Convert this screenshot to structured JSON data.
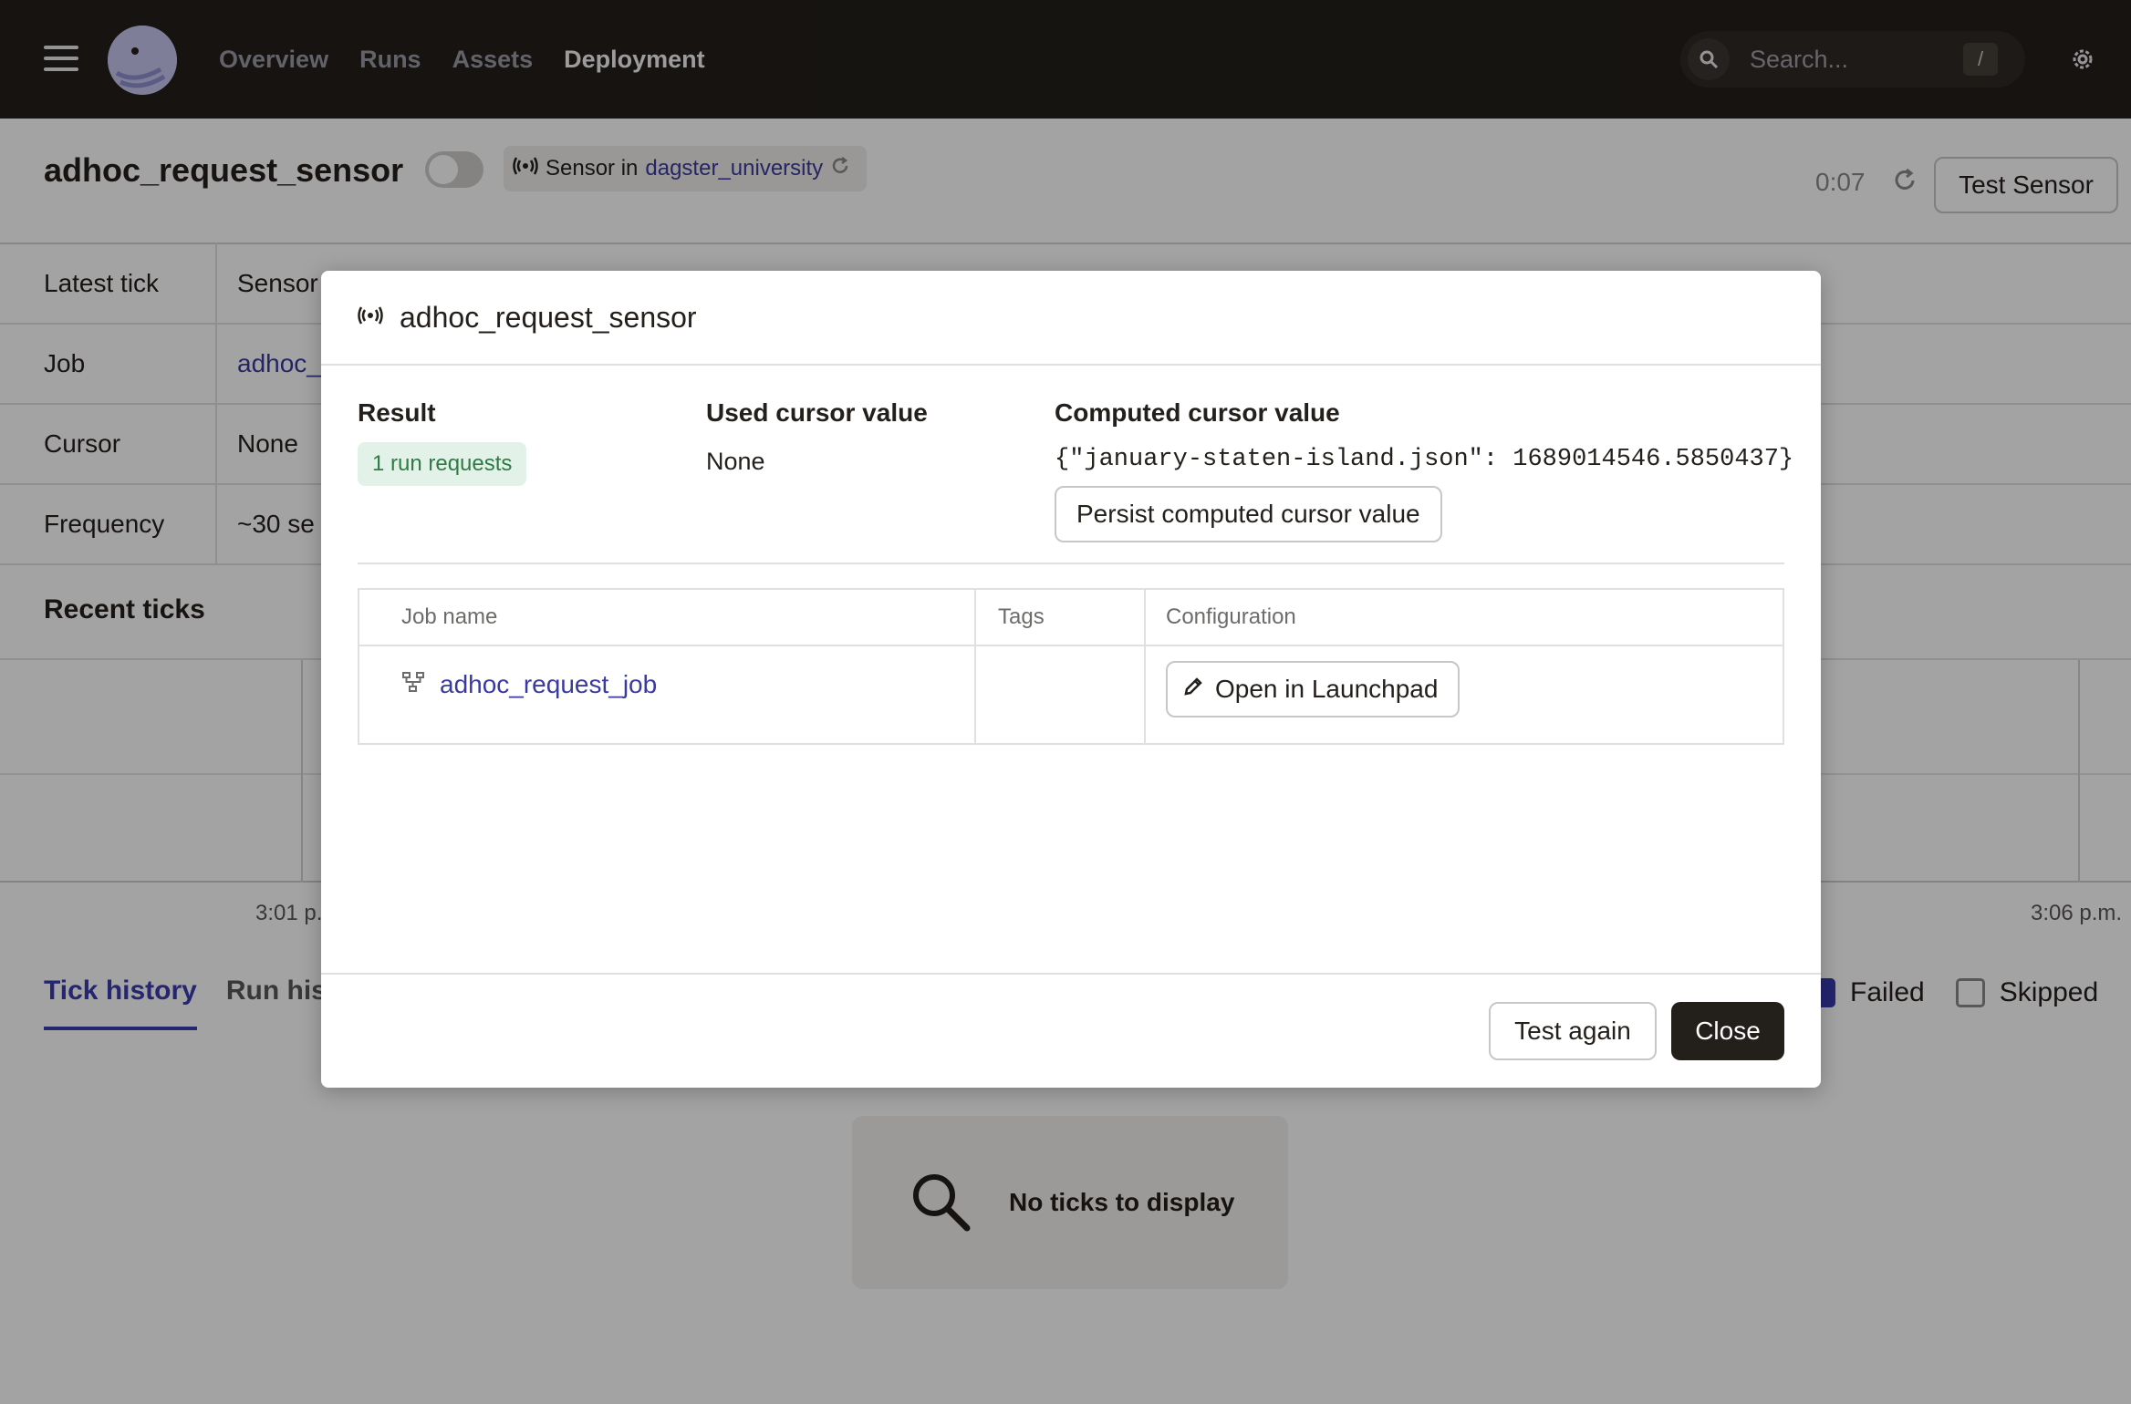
{
  "nav": {
    "links": [
      "Overview",
      "Runs",
      "Assets",
      "Deployment"
    ],
    "active": "Deployment",
    "search_placeholder": "Search...",
    "search_shortcut": "/"
  },
  "header": {
    "title": "adhoc_request_sensor",
    "sensor_tag_prefix": "Sensor in",
    "sensor_tag_location": "dagster_university",
    "timer": "0:07",
    "test_sensor_label": "Test Sensor"
  },
  "details": {
    "rows": [
      {
        "label": "Latest tick",
        "value": "Sensor"
      },
      {
        "label": "Job",
        "value": "adhoc_"
      },
      {
        "label": "Cursor",
        "value": "None"
      },
      {
        "label": "Frequency",
        "value": "~30 se"
      }
    ]
  },
  "recent_ticks": {
    "title": "Recent ticks",
    "time_start": "3:01 p.",
    "time_end": "3:06 p.m."
  },
  "tabs": {
    "items": [
      "Tick history",
      "Run hist"
    ],
    "filters": [
      {
        "label": "Failed",
        "checked": true
      },
      {
        "label": "Skipped",
        "checked": false
      }
    ]
  },
  "empty_state": {
    "text": "No ticks to display"
  },
  "modal": {
    "title": "adhoc_request_sensor",
    "result_title": "Result",
    "result_pill": "1 run requests",
    "used_cursor_title": "Used cursor value",
    "used_cursor_value": "None",
    "computed_cursor_title": "Computed cursor value",
    "computed_cursor_value": "{\"january-staten-island.json\": 1689014546.5850437}",
    "persist_label": "Persist computed cursor value",
    "table": {
      "headers": [
        "Job name",
        "Tags",
        "Configuration"
      ],
      "job_name": "adhoc_request_job",
      "launchpad_label": "Open in Launchpad"
    },
    "test_again_label": "Test again",
    "close_label": "Close"
  }
}
